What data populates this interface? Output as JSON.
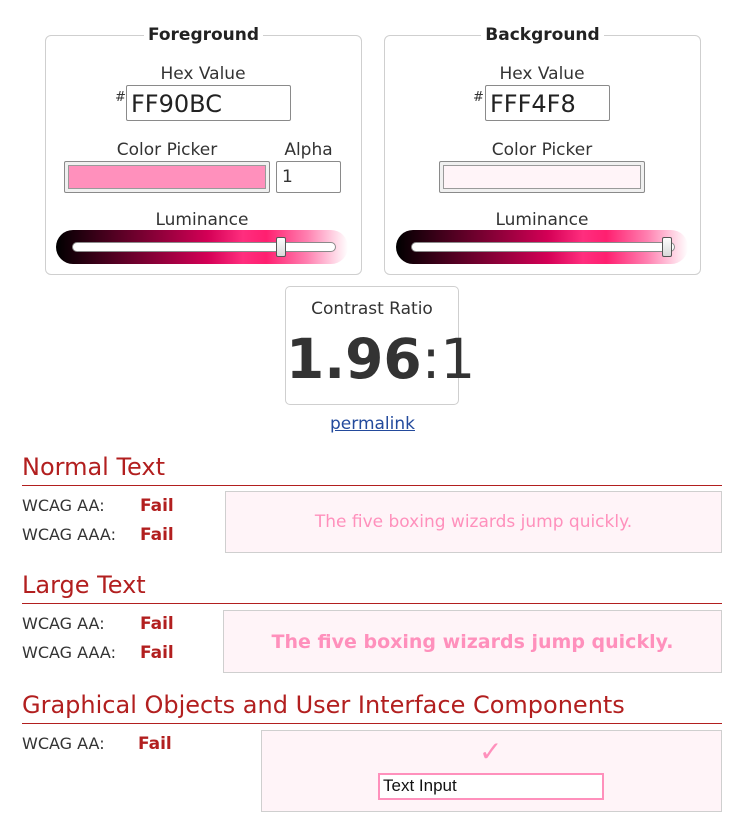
{
  "colors": {
    "foreground": "#FF90BC",
    "background": "#FFF4F8",
    "error_red": "#B21F1F",
    "link_blue": "#234A9C"
  },
  "foreground_panel": {
    "title": "Foreground",
    "hex_label": "Hex Value",
    "hash": "#",
    "hex_value": "FF90BC",
    "picker_label": "Color Picker",
    "alpha_label": "Alpha",
    "alpha_value": "1",
    "luminance_label": "Luminance",
    "luminance_level": 0.79
  },
  "background_panel": {
    "title": "Background",
    "hex_label": "Hex Value",
    "hash": "#",
    "hex_value": "FFF4F8",
    "picker_label": "Color Picker",
    "luminance_label": "Luminance",
    "luminance_level": 0.97
  },
  "contrast": {
    "title": "Contrast Ratio",
    "ratio_main": "1.96",
    "ratio_suffix": ":1",
    "permalink": "permalink"
  },
  "normal_text": {
    "title": "Normal Text",
    "aa_label": "WCAG AA:",
    "aa_result": "Fail",
    "aaa_label": "WCAG AAA:",
    "aaa_result": "Fail",
    "sample": "The five boxing wizards jump quickly."
  },
  "large_text": {
    "title": "Large Text",
    "aa_label": "WCAG AA:",
    "aa_result": "Fail",
    "aaa_label": "WCAG AAA:",
    "aaa_result": "Fail",
    "sample": "The five boxing wizards jump quickly."
  },
  "graphical": {
    "title": "Graphical Objects and User Interface Components",
    "aa_label": "WCAG AA:",
    "aa_result": "Fail",
    "check_icon": "✓",
    "text_input_value": "Text Input"
  }
}
